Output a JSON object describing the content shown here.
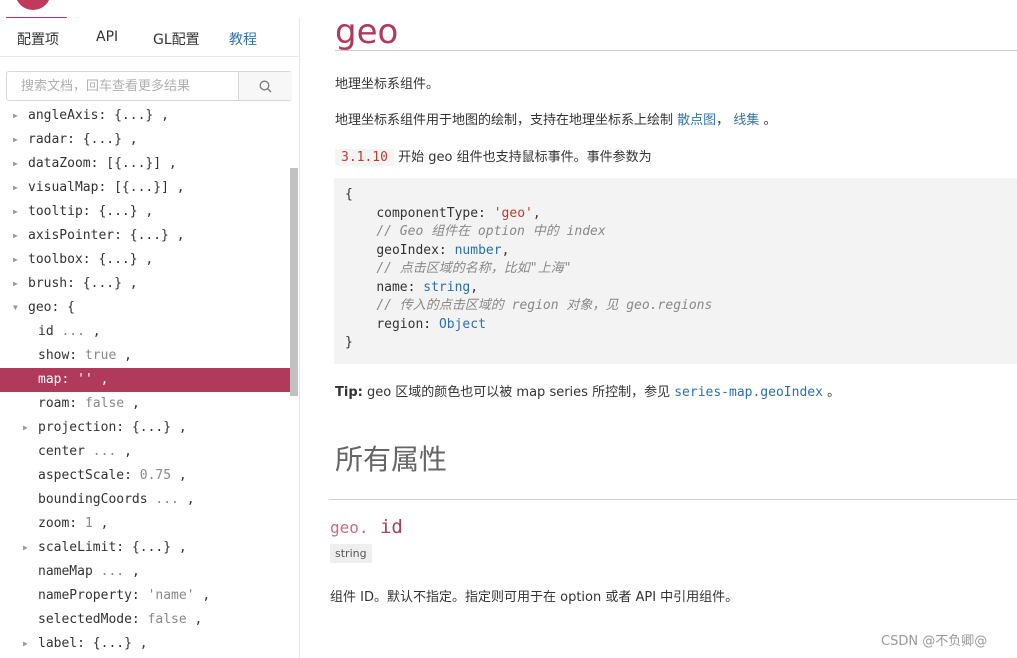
{
  "tabs": [
    "配置项",
    "API",
    "GL配置",
    "教程"
  ],
  "search": {
    "placeholder": "搜索文档，回车查看更多结果"
  },
  "tree": [
    {
      "key": "angleAxis:",
      "value": "{...}",
      "suffix": ",",
      "arrow": "right",
      "indent": 0
    },
    {
      "key": "radar:",
      "value": "{...}",
      "suffix": ",",
      "arrow": "right",
      "indent": 0
    },
    {
      "key": "dataZoom:",
      "value": "[{...}]",
      "suffix": ",",
      "arrow": "right",
      "indent": 0
    },
    {
      "key": "visualMap:",
      "value": "[{...}]",
      "suffix": ",",
      "arrow": "right",
      "indent": 0
    },
    {
      "key": "tooltip:",
      "value": "{...}",
      "suffix": ",",
      "arrow": "right",
      "indent": 0
    },
    {
      "key": "axisPointer:",
      "value": "{...}",
      "suffix": ",",
      "arrow": "right",
      "indent": 0
    },
    {
      "key": "toolbox:",
      "value": "{...}",
      "suffix": ",",
      "arrow": "right",
      "indent": 0
    },
    {
      "key": "brush:",
      "value": "{...}",
      "suffix": ",",
      "arrow": "right",
      "indent": 0
    },
    {
      "key": "geo:",
      "value": "{",
      "suffix": "",
      "arrow": "down",
      "indent": 0
    },
    {
      "key": "id",
      "value": "...",
      "suffix": ",",
      "arrow": "",
      "indent": 1,
      "muted": true
    },
    {
      "key": "show:",
      "value": "true",
      "suffix": ",",
      "arrow": "",
      "indent": 1,
      "muted": true
    },
    {
      "key": "map:",
      "value": "''",
      "suffix": ",",
      "arrow": "",
      "indent": 1,
      "selected": true
    },
    {
      "key": "roam:",
      "value": "false",
      "suffix": ",",
      "arrow": "",
      "indent": 1,
      "muted": true
    },
    {
      "key": "projection:",
      "value": "{...}",
      "suffix": ",",
      "arrow": "right",
      "indent": 1
    },
    {
      "key": "center",
      "value": "...",
      "suffix": ",",
      "arrow": "",
      "indent": 1,
      "muted": true
    },
    {
      "key": "aspectScale:",
      "value": "0.75",
      "suffix": ",",
      "arrow": "",
      "indent": 1,
      "muted": true
    },
    {
      "key": "boundingCoords",
      "value": "...",
      "suffix": ",",
      "arrow": "",
      "indent": 1,
      "muted": true
    },
    {
      "key": "zoom:",
      "value": "1",
      "suffix": ",",
      "arrow": "",
      "indent": 1,
      "muted": true
    },
    {
      "key": "scaleLimit:",
      "value": "{...}",
      "suffix": ",",
      "arrow": "right",
      "indent": 1
    },
    {
      "key": "nameMap",
      "value": "...",
      "suffix": ",",
      "arrow": "",
      "indent": 1,
      "muted": true
    },
    {
      "key": "nameProperty:",
      "value": "'name'",
      "suffix": ",",
      "arrow": "",
      "indent": 1,
      "muted": true
    },
    {
      "key": "selectedMode:",
      "value": "false",
      "suffix": ",",
      "arrow": "",
      "indent": 1,
      "muted": true
    },
    {
      "key": "label:",
      "value": "{...}",
      "suffix": ",",
      "arrow": "right",
      "indent": 1
    }
  ],
  "main": {
    "title": "geo",
    "intro": "地理坐标系组件。",
    "desc_prefix": "地理坐标系组件用于地图的绘制，支持在地理坐标系上绘制",
    "desc_link1": "散点图",
    "desc_sep": "，",
    "desc_link2": "线集",
    "desc_end": "。",
    "version": "3.1.10",
    "version_text": "开始 geo 组件也支持鼠标事件。事件参数为",
    "code": {
      "open": "{",
      "line1_key": "componentType: ",
      "line1_val": "'geo'",
      "line1_end": ",",
      "comment1": "// Geo 组件在 option 中的 index",
      "line2_key": "geoIndex: ",
      "line2_val": "number",
      "line2_end": ",",
      "comment2": "// 点击区域的名称，比如\"上海\"",
      "line3_key": "name: ",
      "line3_val": "string",
      "line3_end": ",",
      "comment3": "// 传入的点击区域的 region 对象，见 geo.regions",
      "line4_key": "region: ",
      "line4_val": "Object",
      "close": "}"
    },
    "tip_label": "Tip:",
    "tip_text": " geo 区域的颜色也可以被 map series 所控制，参见 ",
    "tip_link": "series-map.geoIndex",
    "tip_end": " 。",
    "section_title": "所有属性",
    "prop_prefix": "geo.",
    "prop_name": " id",
    "prop_type": "string",
    "prop_desc": "组件 ID。默认不指定。指定则可用于在 option 或者 API 中引用组件。"
  },
  "watermark": "CSDN @不负卿@",
  "colors": {
    "accent": "#b03a5b",
    "link": "#3373a8"
  }
}
